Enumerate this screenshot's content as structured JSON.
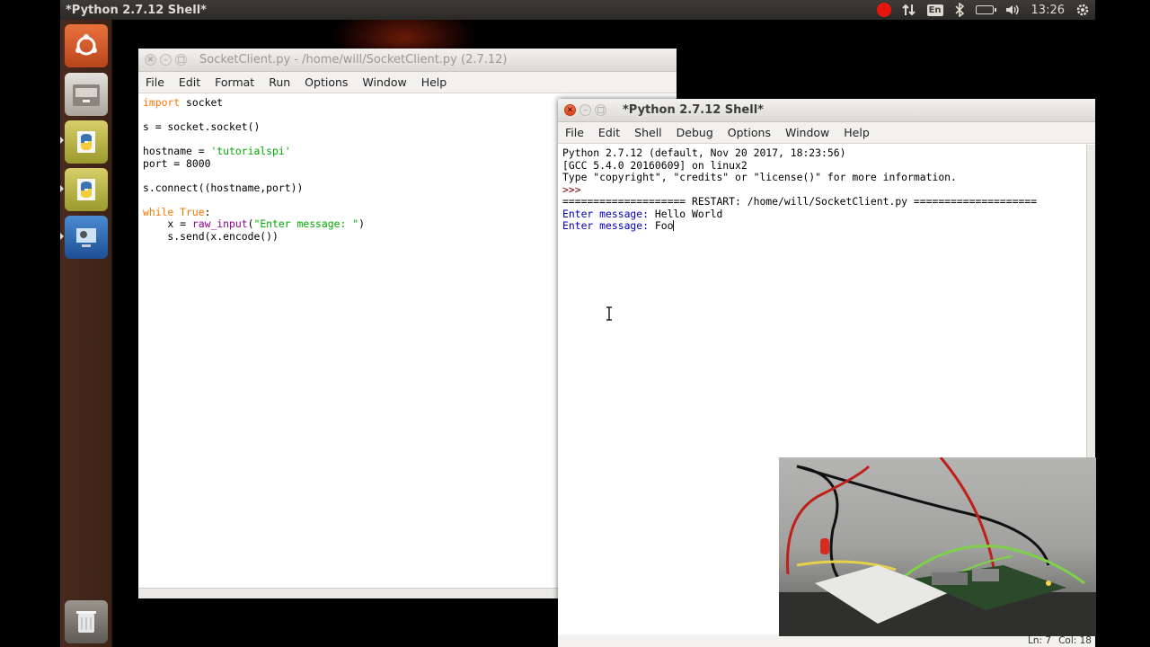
{
  "top_panel": {
    "app_title": "*Python 2.7.12 Shell*",
    "keyboard_layout": "En",
    "time": "13:26",
    "icons": [
      "record-icon",
      "network-icon",
      "keyboard-layout-icon",
      "bluetooth-icon",
      "battery-icon",
      "volume-icon",
      "settings-gear-icon"
    ],
    "record_color": "#e8150f"
  },
  "launcher": {
    "items": [
      "ubuntu-dash-icon",
      "files-icon",
      "python-idle-icon",
      "python-idle-icon",
      "system-settings-icon",
      "trash-icon"
    ]
  },
  "editor_window": {
    "title": "SocketClient.py - /home/will/SocketClient.py (2.7.12)",
    "menus": [
      "File",
      "Edit",
      "Format",
      "Run",
      "Options",
      "Window",
      "Help"
    ],
    "code_lines": [
      [
        {
          "t": "import",
          "c": "kw"
        },
        {
          "t": " socket",
          "c": ""
        }
      ],
      [],
      [
        {
          "t": "s = socket.socket()",
          "c": ""
        }
      ],
      [],
      [
        {
          "t": "hostname = ",
          "c": ""
        },
        {
          "t": "'tutorialspi'",
          "c": "str"
        }
      ],
      [
        {
          "t": "port = 8000",
          "c": ""
        }
      ],
      [],
      [
        {
          "t": "s.connect((hostname,port))",
          "c": ""
        }
      ],
      [],
      [
        {
          "t": "while",
          "c": "kw"
        },
        {
          "t": " ",
          "c": ""
        },
        {
          "t": "True",
          "c": "kw"
        },
        {
          "t": ":",
          "c": ""
        }
      ],
      [
        {
          "t": "    x = ",
          "c": ""
        },
        {
          "t": "raw_input",
          "c": "bi"
        },
        {
          "t": "(",
          "c": ""
        },
        {
          "t": "\"Enter message: \"",
          "c": "str"
        },
        {
          "t": ")",
          "c": ""
        }
      ],
      [
        {
          "t": "    s.send(x.encode())",
          "c": ""
        }
      ]
    ]
  },
  "shell_window": {
    "title": "*Python 2.7.12 Shell*",
    "menus": [
      "File",
      "Edit",
      "Shell",
      "Debug",
      "Options",
      "Window",
      "Help"
    ],
    "lines": [
      [
        {
          "t": "Python 2.7.12 (default, Nov 20 2017, 18:23:56)",
          "c": ""
        }
      ],
      [
        {
          "t": "[GCC 5.4.0 20160609] on linux2",
          "c": ""
        }
      ],
      [
        {
          "t": "Type \"copyright\", \"credits\" or \"license()\" for more information.",
          "c": ""
        }
      ],
      [
        {
          "t": ">>> ",
          "c": "prompt"
        }
      ],
      [
        {
          "t": "==================== RESTART: /home/will/SocketClient.py ====================",
          "c": ""
        }
      ],
      [
        {
          "t": "Enter message: ",
          "c": "out"
        },
        {
          "t": "Hello World",
          "c": "stdin"
        }
      ],
      [
        {
          "t": "Enter message: ",
          "c": "out"
        },
        {
          "t": "Foo",
          "c": "stdin"
        }
      ]
    ],
    "status": {
      "line": "Ln: 7",
      "col": "Col: 18"
    }
  },
  "colors": {
    "keyword": "#ff7700",
    "string": "#00aa00",
    "builtin": "#900090",
    "stdout": "#0000c0",
    "prompt": "#800000"
  }
}
